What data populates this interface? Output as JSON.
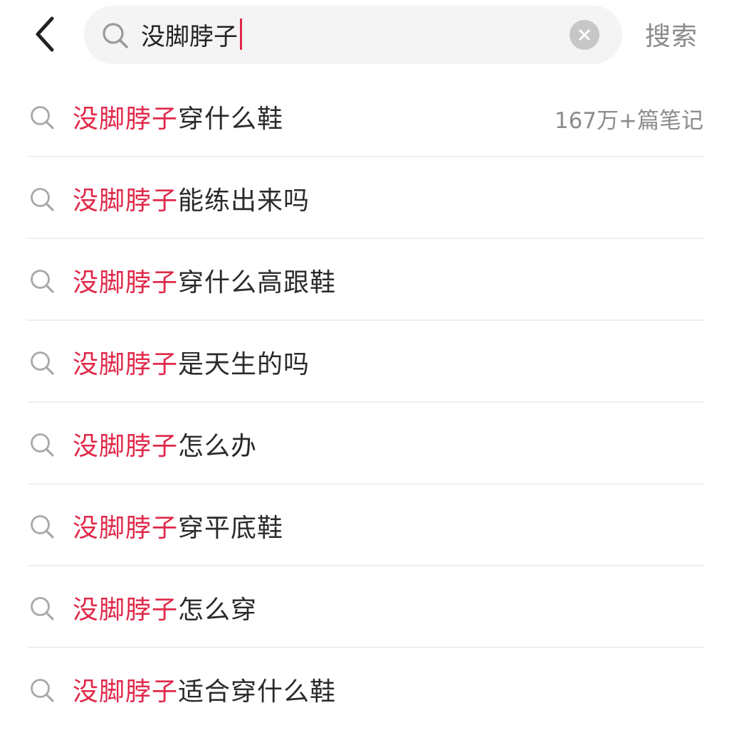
{
  "header": {
    "back_icon": "chevron-left-icon",
    "search": {
      "icon": "search-icon",
      "value": "没脚脖子",
      "clear_icon": "close-icon"
    },
    "submit_label": "搜索"
  },
  "colors": {
    "highlight": "#e0294a",
    "caret": "#e0294a",
    "muted": "#8c8c8c",
    "search_bg": "#f4f4f4"
  },
  "suggestions": [
    {
      "highlight": "没脚脖子",
      "rest": "穿什么鞋",
      "count": "167万+篇笔记"
    },
    {
      "highlight": "没脚脖子",
      "rest": "能练出来吗"
    },
    {
      "highlight": "没脚脖子",
      "rest": "穿什么高跟鞋"
    },
    {
      "highlight": "没脚脖子",
      "rest": "是天生的吗"
    },
    {
      "highlight": "没脚脖子",
      "rest": "怎么办"
    },
    {
      "highlight": "没脚脖子",
      "rest": "穿平底鞋"
    },
    {
      "highlight": "没脚脖子",
      "rest": "怎么穿"
    },
    {
      "highlight": "没脚脖子",
      "rest": "适合穿什么鞋"
    }
  ]
}
